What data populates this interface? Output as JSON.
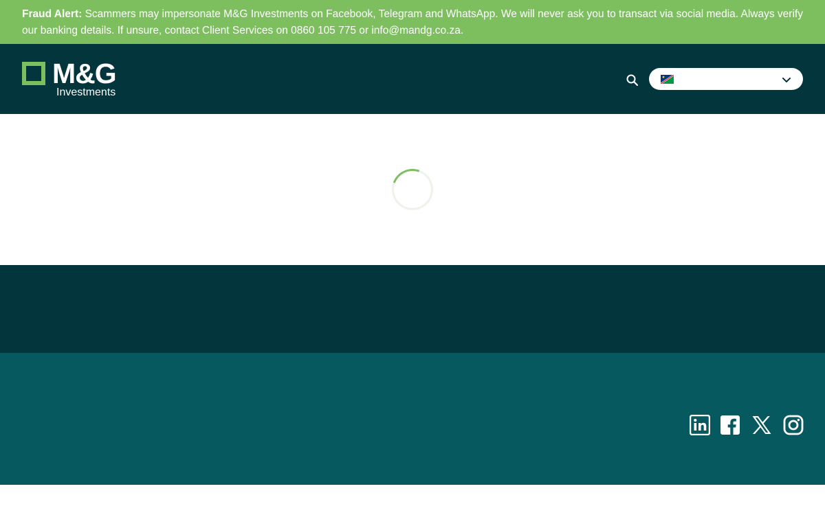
{
  "fraud_alert": {
    "label": "Fraud Alert:",
    "message": " Scammers may impersonate M&G Investments on Facebook, Telegram and WhatsApp. We will never ask you to transact via social media. Always verify our banking details. If unsure, contact Client Services on 0860 105 775 or info@mandg.co.za."
  },
  "header": {
    "logo_brand": "M&G",
    "logo_sub": "Investments",
    "search_icon": "search-icon",
    "country_select": {
      "flag_icon": "namibia-flag-icon",
      "chevron_icon": "chevron-down-icon"
    }
  },
  "content": {
    "loader": "loading-spinner"
  },
  "footer": {
    "social": [
      "linkedin-icon",
      "facebook-icon",
      "x-icon",
      "instagram-icon"
    ]
  },
  "colors": {
    "banner_green": "#7dbf5f",
    "header_dark": "#03353d",
    "footer_teal": "#075960",
    "white": "#ffffff"
  }
}
